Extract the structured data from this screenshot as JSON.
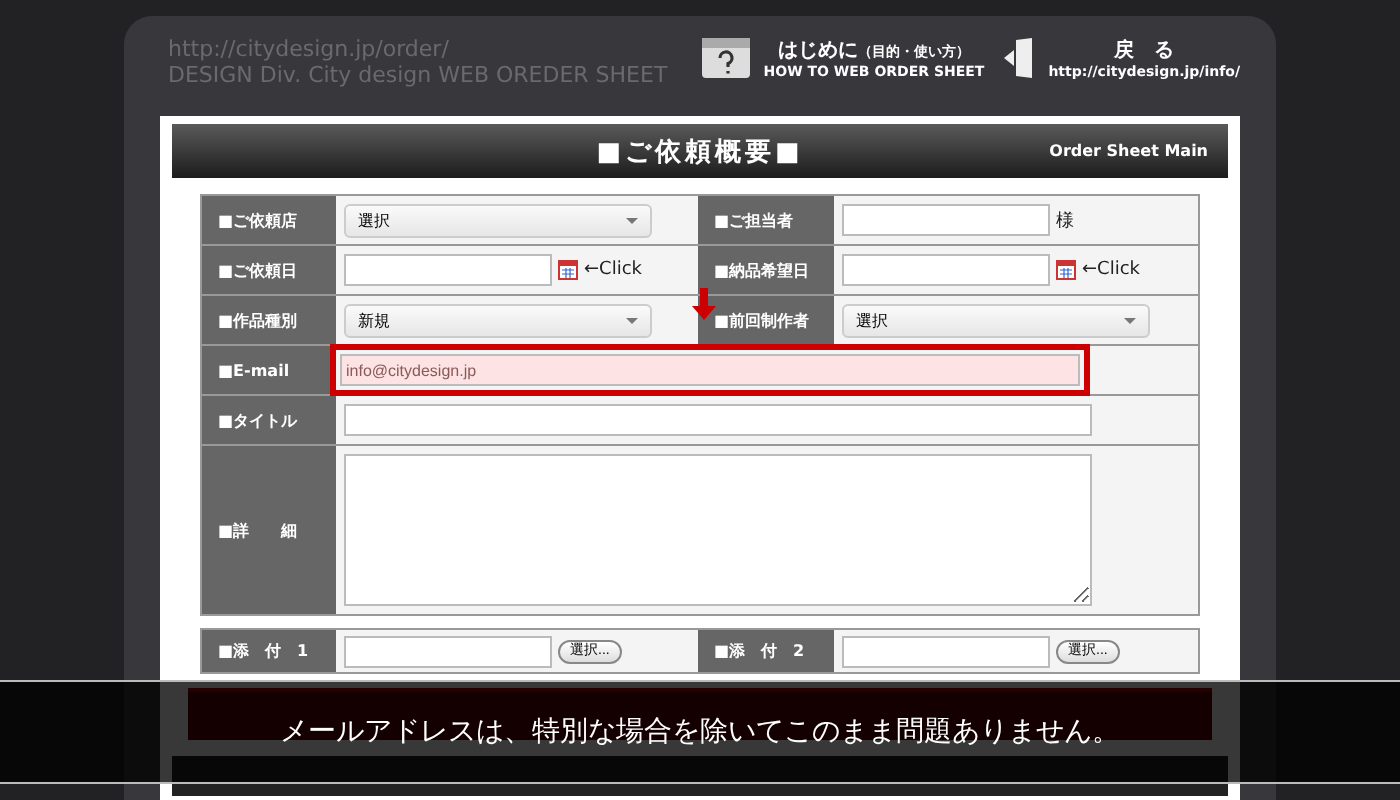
{
  "header": {
    "url": "http://citydesign.jp/order/",
    "subtitle": "DESIGN Div. City design WEB OREDER SHEET",
    "help": {
      "title": "はじめに",
      "title_note": "（目的・使い方）",
      "subtitle": "HOW TO WEB ORDER SHEET"
    },
    "back": {
      "title": "戻　る",
      "url": "http://citydesign.jp/info/"
    }
  },
  "section": {
    "title": "■ご依頼概要■",
    "subtitle": "Order Sheet Main"
  },
  "pair_rows": [
    {
      "left": {
        "label": "■ご依頼店",
        "kind": "select",
        "value": "選択"
      },
      "right": {
        "label": "■ご担当者",
        "kind": "text",
        "suffix": "様"
      }
    },
    {
      "left": {
        "label": "■ご依頼日",
        "kind": "date",
        "link": "←Click"
      },
      "right": {
        "label": "■納品希望日",
        "kind": "date",
        "link": "←Click"
      }
    },
    {
      "left": {
        "label": "■作品種別",
        "kind": "select",
        "value": "新規"
      },
      "right": {
        "label": "■前回制作者",
        "kind": "select",
        "value": "選択"
      }
    }
  ],
  "full_rows": [
    {
      "label": "■E-mail",
      "kind": "text",
      "value": "info@citydesign.jp",
      "highlighted": true
    },
    {
      "label": "■タイトル",
      "kind": "text",
      "highlighted": false
    },
    {
      "label": "■詳　　細",
      "kind": "textarea",
      "highlighted": false
    }
  ],
  "attachments": [
    {
      "label": "■添　付　1",
      "button": "選択..."
    },
    {
      "label": "■添　付　2",
      "button": "選択..."
    }
  ],
  "caption": "メールアドレスは、特別な場合を除いてこのまま問題ありません。"
}
